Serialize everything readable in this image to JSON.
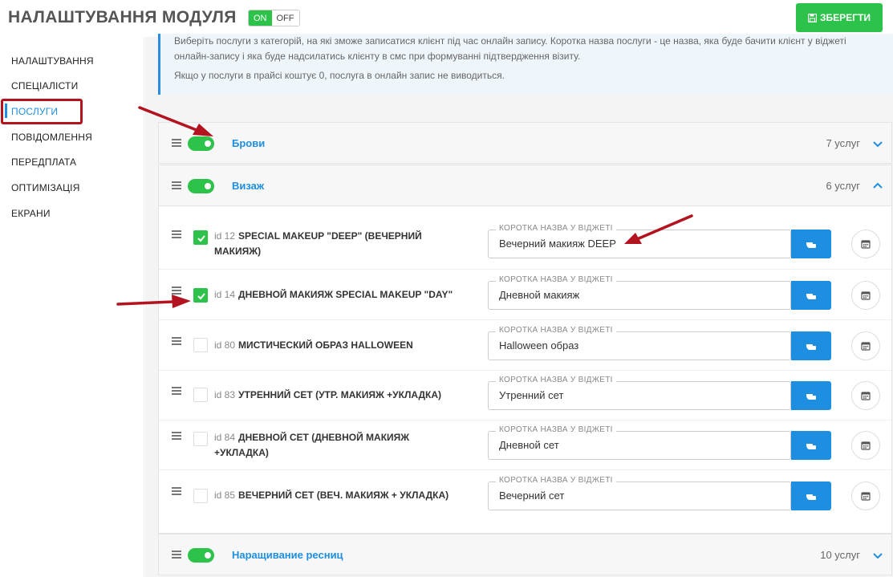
{
  "header": {
    "title": "НАЛАШТУВАННЯ МОДУЛЯ",
    "toggle_on": "ON",
    "toggle_off": "OFF",
    "save_label": "ЗБЕРЕГТИ"
  },
  "sidebar": {
    "items": [
      {
        "label": "НАЛАШТУВАННЯ"
      },
      {
        "label": "СПЕЦІАЛІСТИ"
      },
      {
        "label": "ПОСЛУГИ"
      },
      {
        "label": "ПОВІДОМЛЕННЯ"
      },
      {
        "label": "ПЕРЕДПЛАТА"
      },
      {
        "label": "ОПТИМІЗАЦІЯ"
      },
      {
        "label": "ЕКРАНИ"
      }
    ],
    "active": "ПОСЛУГИ"
  },
  "info": {
    "line1": "Виберіть послуги з категорій, на які зможе записатися клієнт під час онлайн запису. Коротка назва послуги - це назва, яка буде бачити клієнт у віджеті",
    "line2": "онлайн-запису і яка буде надсилатись клієнту в смс при формуванні підтвердження візиту.",
    "line3": "Якщо у послуги в прайсі коштує 0, послуга в онлайн запис не виводиться."
  },
  "categories": [
    {
      "name": "Брови",
      "count": "7 услуг",
      "enabled": true,
      "expanded": false
    },
    {
      "name": "Визаж",
      "count": "6 услуг",
      "enabled": true,
      "expanded": true
    },
    {
      "name": "Наращивание ресниц",
      "count": "10 услуг",
      "enabled": true,
      "expanded": false
    }
  ],
  "services": [
    {
      "id": "id 12",
      "name": "SPECIAL MAKEUP \"DEEP\" (ВЕЧЕРНИЙ МАКИЯЖ)",
      "checked": true,
      "field_label": "КОРОТКА НАЗВА У ВІДЖЕТІ",
      "short_name": "Вечерний макияж DEEP"
    },
    {
      "id": "id 14",
      "name": "ДНЕВНОЙ МАКИЯЖ SPECIAL MAKEUP \"DAY\"",
      "checked": true,
      "field_label": "КОРОТКА НАЗВА У ВІДЖЕТІ",
      "short_name": "Дневной макияж"
    },
    {
      "id": "id 80",
      "name": "МИСТИЧЕСКИЙ ОБРАЗ HALLOWEEN",
      "checked": false,
      "field_label": "КОРОТКА НАЗВА У ВІДЖЕТІ",
      "short_name": "Halloween образ"
    },
    {
      "id": "id 83",
      "name": "УТРЕННИЙ СЕТ (УТР. МАКИЯЖ +УКЛАДКА)",
      "checked": false,
      "field_label": "КОРОТКА НАЗВА У ВІДЖЕТІ",
      "short_name": "Утренний сет"
    },
    {
      "id": "id 84",
      "name": "ДНЕВНОЙ СЕТ (ДНЕВНОЙ МАКИЯЖ +УКЛАДКА)",
      "checked": false,
      "field_label": "КОРОТКА НАЗВА У ВІДЖЕТІ",
      "short_name": "Дневной сет"
    },
    {
      "id": "id 85",
      "name": "ВЕЧЕРНИЙ СЕТ (ВЕЧ. МАКИЯЖ + УКЛАДКА)",
      "checked": false,
      "field_label": "КОРОТКА НАЗВА У ВІДЖЕТІ",
      "short_name": "Вечерний сет"
    }
  ],
  "colors": {
    "accent": "#1e8fe0",
    "green": "#2dc24a",
    "annotation_red": "#b3121f"
  }
}
